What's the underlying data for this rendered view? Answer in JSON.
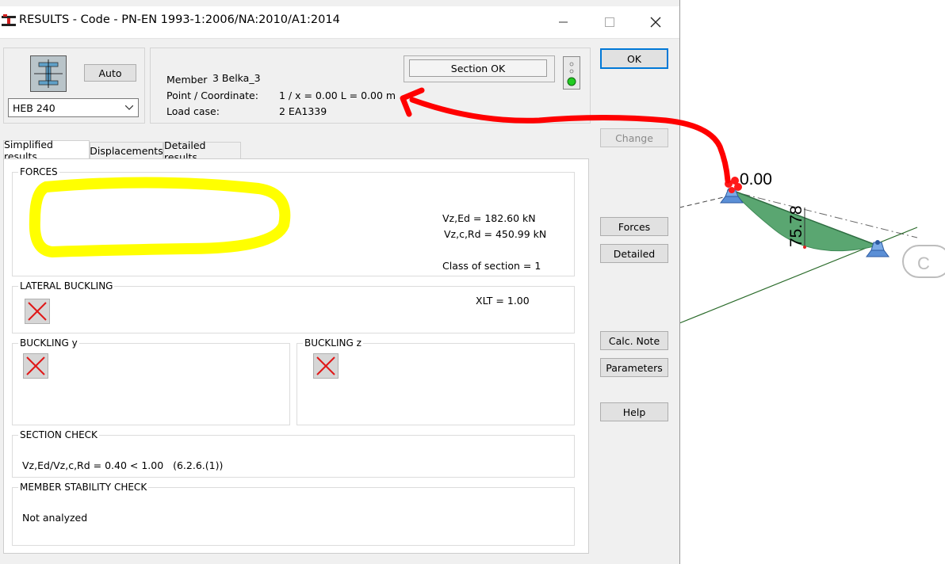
{
  "window": {
    "title": "RESULTS - Code - PN-EN 1993-1:2006/NA:2010/A1:2014"
  },
  "header": {
    "auto_label": "Auto",
    "section_value": "HEB 240",
    "member_label": "Member",
    "member_value": "3  Belka_3",
    "point_label": "Point / Coordinate:",
    "point_value": "1 / x = 0.00 L = 0.00 m",
    "loadcase_label": "Load case:",
    "loadcase_value": "2 EA1339",
    "status_text": "Section OK"
  },
  "buttons": {
    "ok": "OK",
    "change": "Change",
    "forces": "Forces",
    "detailed": "Detailed",
    "calc_note": "Calc. Note",
    "parameters": "Parameters",
    "help": "Help"
  },
  "tabs": [
    {
      "label": "Simplified results"
    },
    {
      "label": "Displacements"
    },
    {
      "label": "Detailed results"
    }
  ],
  "forces": {
    "title": "FORCES",
    "vz_ed": "Vz,Ed = 182.60 kN",
    "vz_c_rd": "Vz,c,Rd = 450.99 kN",
    "class": "Class of section = 1"
  },
  "lateral_buckling": {
    "title": "LATERAL BUCKLING",
    "xlt": "XLT = 1.00"
  },
  "buckling_y": {
    "title": "BUCKLING y"
  },
  "buckling_z": {
    "title": "BUCKLING z"
  },
  "section_check": {
    "title": "SECTION CHECK",
    "text": "Vz,Ed/Vz,c,Rd = 0.40 < 1.00   (6.2.6.(1))"
  },
  "member_stability": {
    "title": "MEMBER STABILITY CHECK",
    "text": "Not analyzed"
  },
  "viewport": {
    "value_top": "0.00",
    "value_side": "75.78",
    "letter": "C"
  },
  "colors": {
    "accent": "#0078d7",
    "annotation_red": "#ff0000",
    "annotation_yellow": "#ffff00",
    "diagram_green": "#5aa671",
    "status_led": "#22cc22"
  }
}
